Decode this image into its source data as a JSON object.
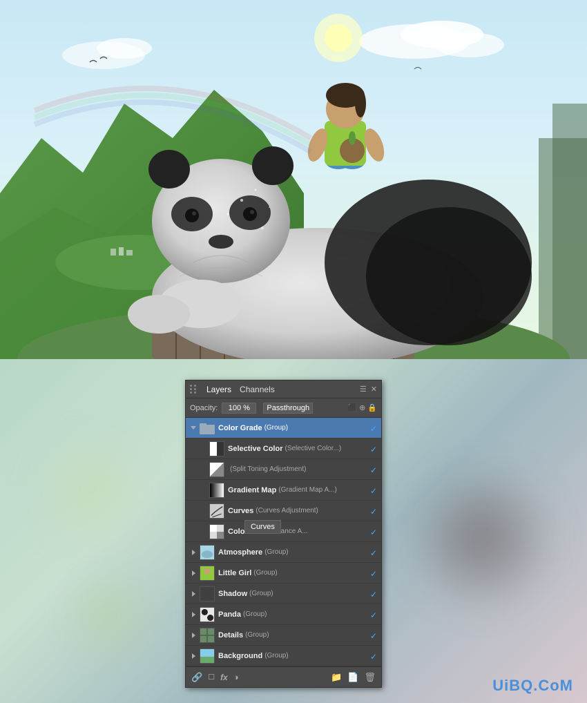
{
  "image": {
    "description": "Panda with girl on mountain landscape",
    "alt": "Photo editing artwork"
  },
  "panel": {
    "title": "Layers panel",
    "tabs": [
      {
        "label": "Layers",
        "active": true
      },
      {
        "label": "Channels",
        "active": false
      }
    ],
    "opacity": {
      "label": "Opacity:",
      "value": "100 %"
    },
    "blend_mode": "Passthrough",
    "layers": [
      {
        "id": "color-grade",
        "name": "Color Grade",
        "type": "(Group)",
        "expanded": true,
        "selected": true,
        "visible": true,
        "indent": 0,
        "has_expand": true,
        "expand_state": "down",
        "thumb_type": "folder"
      },
      {
        "id": "selective-color",
        "name": "Selective Color",
        "type": "(Selective Color...)",
        "expanded": false,
        "selected": false,
        "visible": true,
        "indent": 1,
        "has_expand": false,
        "thumb_type": "sel-color"
      },
      {
        "id": "split-toning",
        "name": "",
        "type": "(Split Toning Adjustment)",
        "expanded": false,
        "selected": false,
        "visible": true,
        "indent": 1,
        "has_expand": false,
        "thumb_type": "sel-color"
      },
      {
        "id": "gradient-map",
        "name": "Gradient Map",
        "type": "(Gradient Map A...)",
        "expanded": false,
        "selected": false,
        "visible": true,
        "indent": 1,
        "has_expand": false,
        "thumb_type": "grad-map"
      },
      {
        "id": "curves",
        "name": "Curves",
        "type": "(Curves Adjustment)",
        "expanded": false,
        "selected": false,
        "visible": true,
        "indent": 1,
        "has_expand": false,
        "thumb_type": "curves"
      },
      {
        "id": "color-balance",
        "name": "Color B",
        "type": "olor Balance A...",
        "expanded": false,
        "selected": false,
        "visible": true,
        "indent": 1,
        "has_expand": false,
        "thumb_type": "col-balance",
        "tooltip": "Curves"
      },
      {
        "id": "atmosphere",
        "name": "Atmosphere",
        "type": "(Group)",
        "expanded": false,
        "selected": false,
        "visible": true,
        "indent": 0,
        "has_expand": true,
        "expand_state": "right",
        "thumb_type": "atmosphere-folder"
      },
      {
        "id": "little-girl",
        "name": "Little Girl",
        "type": "(Group)",
        "expanded": false,
        "selected": false,
        "visible": true,
        "indent": 0,
        "has_expand": true,
        "expand_state": "right",
        "thumb_type": "girl-folder"
      },
      {
        "id": "shadow",
        "name": "Shadow",
        "type": "(Group)",
        "expanded": false,
        "selected": false,
        "visible": true,
        "indent": 0,
        "has_expand": true,
        "expand_state": "right",
        "thumb_type": "shadow-folder"
      },
      {
        "id": "panda",
        "name": "Panda",
        "type": "(Group)",
        "expanded": false,
        "selected": false,
        "visible": true,
        "indent": 0,
        "has_expand": true,
        "expand_state": "right",
        "thumb_type": "panda-folder"
      },
      {
        "id": "details",
        "name": "Details",
        "type": "(Group)",
        "expanded": false,
        "selected": false,
        "visible": true,
        "indent": 0,
        "has_expand": true,
        "expand_state": "right",
        "thumb_type": "details-folder"
      },
      {
        "id": "background",
        "name": "Background",
        "type": "(Group)",
        "expanded": false,
        "selected": false,
        "visible": true,
        "indent": 0,
        "has_expand": true,
        "expand_state": "right",
        "thumb_type": "bg-folder"
      }
    ],
    "footer": {
      "icons": [
        "link",
        "fx",
        "new-layer",
        "delete"
      ]
    }
  },
  "tooltip": {
    "label": "Curves"
  },
  "watermark": {
    "text": "UiBQ.CoM"
  }
}
